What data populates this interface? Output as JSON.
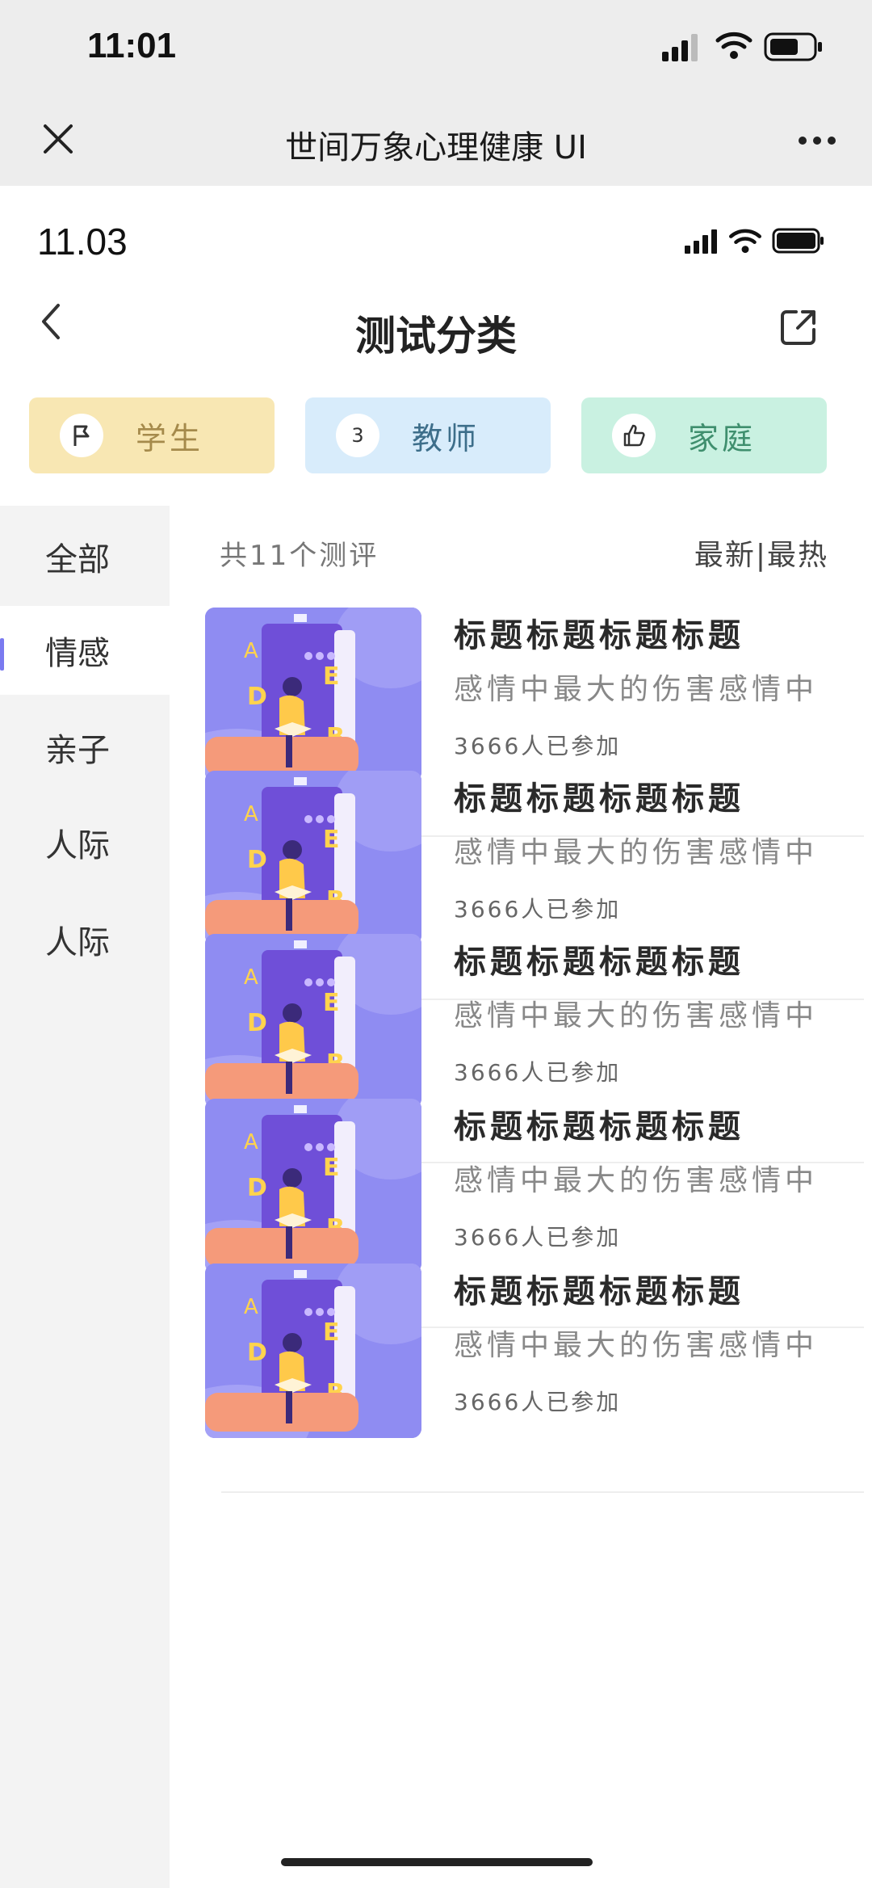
{
  "outer_status": {
    "time": "11:01"
  },
  "wechat_bar": {
    "title": "世间万象心理健康 UI"
  },
  "inner_status": {
    "time": "11.03"
  },
  "nav": {
    "title": "测试分类"
  },
  "category_tabs": [
    {
      "label": "学生",
      "icon": "flag-icon",
      "bg": "#f8e7b3",
      "color": "#a58a4b"
    },
    {
      "label": "教师",
      "icon_text": "3",
      "icon": "number-badge-icon",
      "bg": "#d8ecfb",
      "color": "#3d6e8a"
    },
    {
      "label": "家庭",
      "icon": "thumbs-up-icon",
      "bg": "#c9f1e1",
      "color": "#3f8f6e"
    }
  ],
  "sidebar": {
    "items": [
      {
        "label": "全部",
        "active": false
      },
      {
        "label": "情感",
        "active": true
      },
      {
        "label": "亲子",
        "active": false
      },
      {
        "label": "人际",
        "active": false
      },
      {
        "label": "人际",
        "active": false
      }
    ]
  },
  "list": {
    "count_text": "共11个测评",
    "sort_text": "最新|最热",
    "items": [
      {
        "title": "标题标题标题标题",
        "desc": "感情中最大的伤害感情中",
        "count": "3666人已参加"
      },
      {
        "title": "标题标题标题标题",
        "desc": "感情中最大的伤害感情中",
        "count": "3666人已参加"
      },
      {
        "title": "标题标题标题标题",
        "desc": "感情中最大的伤害感情中",
        "count": "3666人已参加"
      },
      {
        "title": "标题标题标题标题",
        "desc": "感情中最大的伤害感情中",
        "count": "3666人已参加"
      },
      {
        "title": "标题标题标题标题",
        "desc": "感情中最大的伤害感情中",
        "count": "3666人已参加"
      }
    ]
  },
  "colors": {
    "accent": "#7a7af0",
    "thumb_bg": "#8a86f0"
  }
}
